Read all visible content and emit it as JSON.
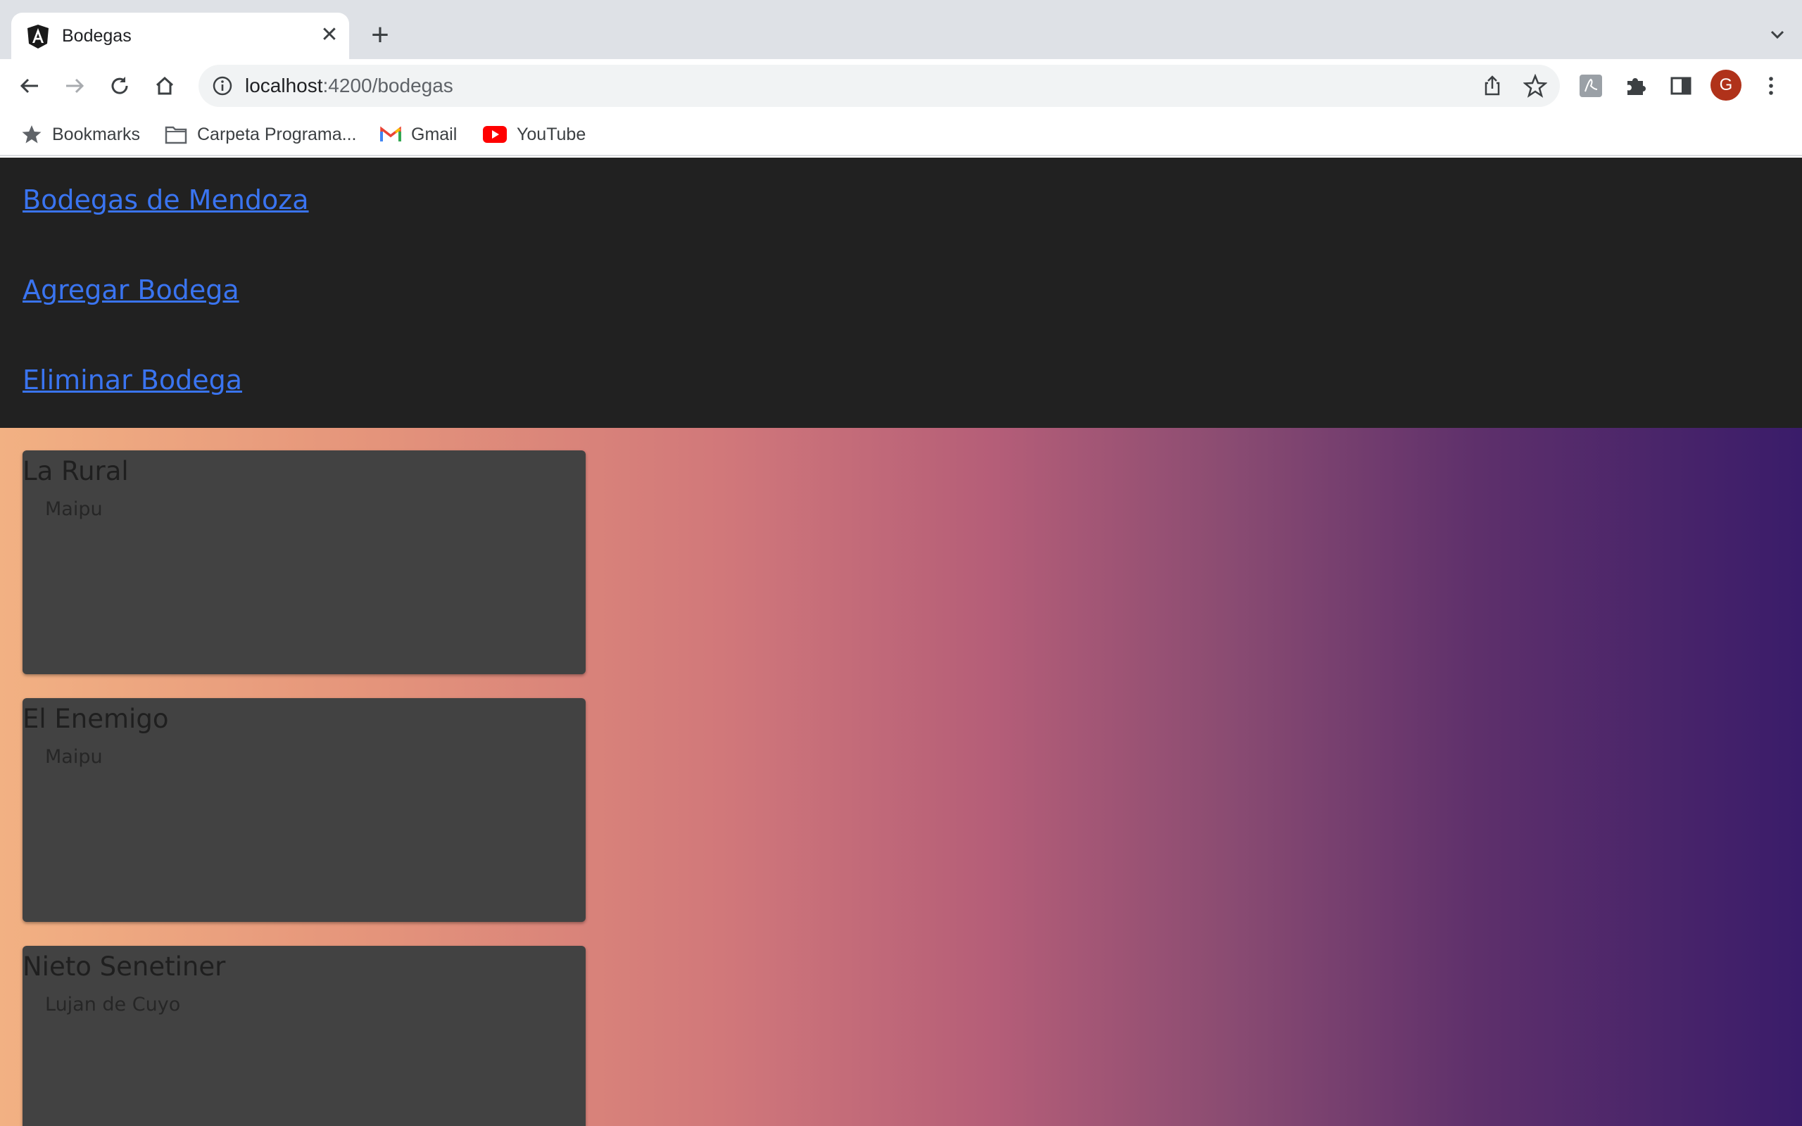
{
  "browser": {
    "tab_title": "Bodegas",
    "url_host": "localhost",
    "url_path": ":4200/bodegas",
    "avatar_letter": "G",
    "bookmarks": [
      {
        "label": "Bookmarks",
        "icon": "star-icon"
      },
      {
        "label": "Carpeta Programa...",
        "icon": "folder-icon"
      },
      {
        "label": "Gmail",
        "icon": "gmail-icon"
      },
      {
        "label": "YouTube",
        "icon": "youtube-icon"
      }
    ]
  },
  "nav": {
    "links": [
      {
        "label": "Bodegas de Mendoza"
      },
      {
        "label": "Agregar Bodega"
      },
      {
        "label": "Eliminar Bodega"
      }
    ]
  },
  "bodegas": [
    {
      "name": "La Rural",
      "location": "Maipu"
    },
    {
      "name": "El Enemigo",
      "location": "Maipu"
    },
    {
      "name": "Nieto Senetiner",
      "location": "Lujan de Cuyo"
    }
  ],
  "colors": {
    "navbar_bg": "#212121",
    "link": "#3a74f0",
    "card_bg": "#424242",
    "gradient_start": "#f2b183",
    "gradient_end": "#3a1c6a"
  }
}
